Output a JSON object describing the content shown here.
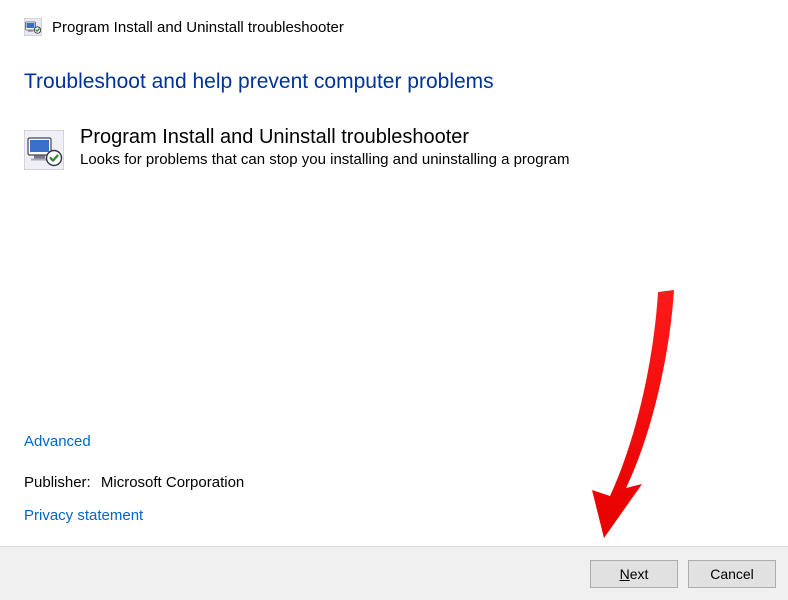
{
  "window": {
    "title": "Program Install and Uninstall troubleshooter"
  },
  "heading": "Troubleshoot and help prevent computer problems",
  "item": {
    "title": "Program Install and Uninstall troubleshooter",
    "description": "Looks for problems that can stop you installing and uninstalling a program"
  },
  "links": {
    "advanced": "Advanced",
    "privacy": "Privacy statement"
  },
  "publisher": {
    "label": "Publisher:",
    "value": "Microsoft Corporation"
  },
  "buttons": {
    "next_prefix": "N",
    "next_rest": "ext",
    "cancel": "Cancel"
  }
}
